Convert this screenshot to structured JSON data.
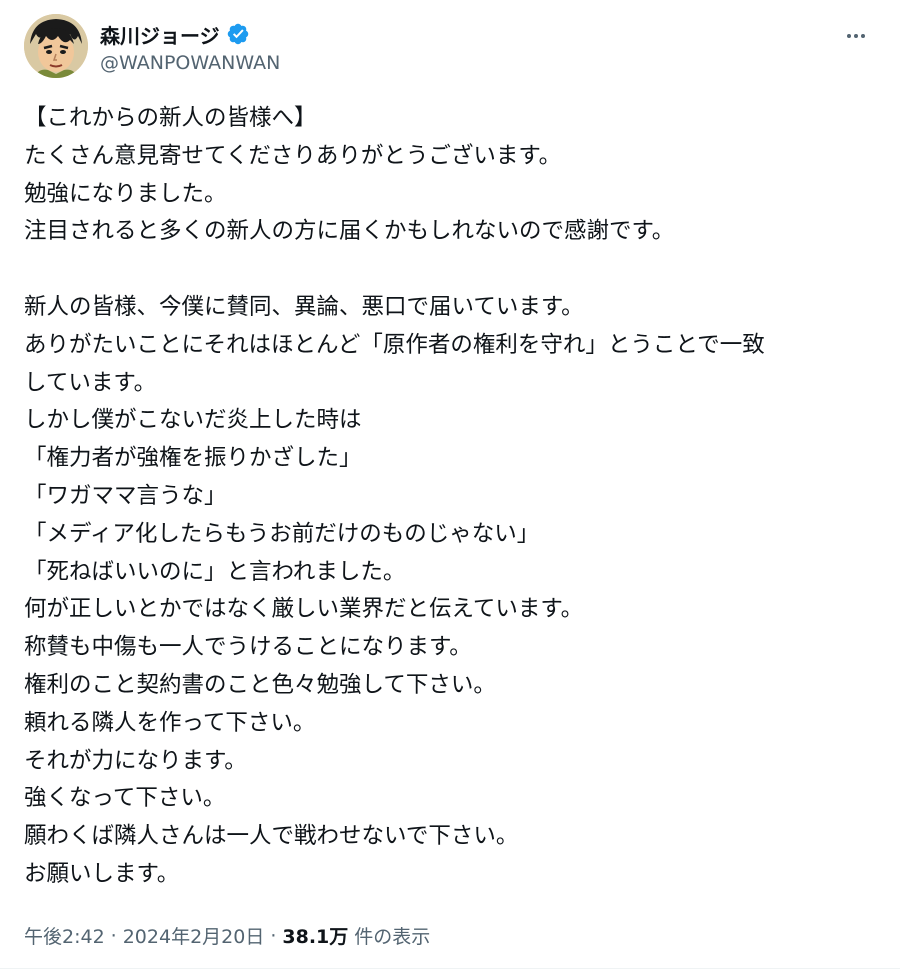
{
  "author": {
    "display_name": "森川ジョージ",
    "handle": "@WANPOWANWAN",
    "verified": true,
    "avatar_icon": "manga-character-avatar-icon",
    "verified_icon": "verified-badge-icon",
    "verified_color": "#1d9bf0"
  },
  "more_icon": "more-options-icon",
  "tweet": {
    "lines": [
      "【これからの新人の皆様へ】",
      "たくさん意見寄せてくださりありがとうございます。",
      "勉強になりました。",
      "注目されると多くの新人の方に届くかもしれないので感謝です。",
      "",
      "新人の皆様、今僕に賛同、異論、悪口で届いています。",
      "ありがたいことにそれはほとんど「原作者の権利を守れ」とうことで一致",
      "しています。",
      "しかし僕がこないだ炎上した時は",
      "「権力者が強権を振りかざした」",
      "「ワガママ言うな」",
      "「メディア化したらもうお前だけのものじゃない」",
      "「死ねばいいのに」と言われました。",
      "何が正しいとかではなく厳しい業界だと伝えています。",
      "称賛も中傷も一人でうけることになります。",
      "権利のこと契約書のこと色々勉強して下さい。",
      "頼れる隣人を作って下さい。",
      "それが力になります。",
      "強くなって下さい。",
      "願わくば隣人さんは一人で戦わせないで下さい。",
      "お願いします。"
    ]
  },
  "meta": {
    "time": "午後2:42",
    "separator": "·",
    "date": "2024年2月20日",
    "views_count": "38.1万",
    "views_label": "件の表示"
  },
  "colors": {
    "text": "#0f1419",
    "secondary": "#536471",
    "background": "#ffffff"
  }
}
